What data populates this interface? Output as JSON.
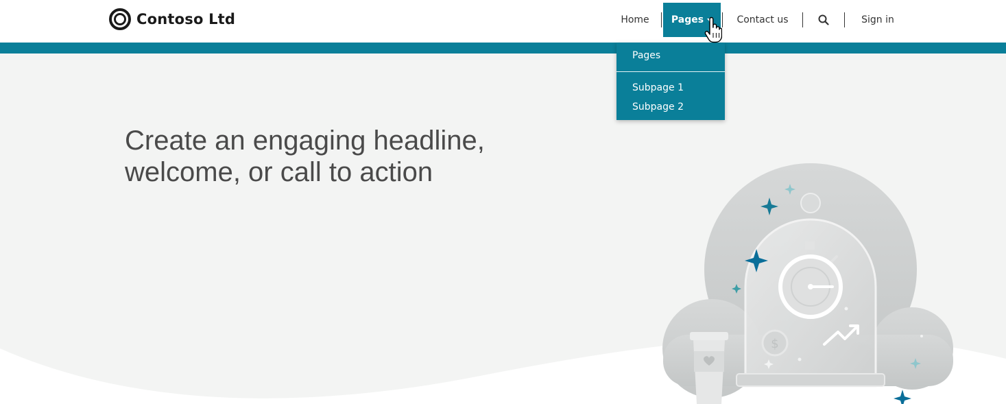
{
  "brand": {
    "name": "Contoso Ltd",
    "logo_icon": "ring-logo-icon"
  },
  "nav": {
    "items": [
      {
        "label": "Home"
      },
      {
        "label": "Pages",
        "active": true
      },
      {
        "label": "Contact us"
      },
      {
        "label": "Search",
        "icon": "search-icon"
      },
      {
        "label": "Sign in"
      }
    ]
  },
  "dropdown": {
    "items": [
      {
        "label": "Pages"
      },
      {
        "label": "Subpage 1"
      },
      {
        "label": "Subpage 2"
      }
    ]
  },
  "hero": {
    "headline": "Create an engaging headline, welcome, or call to action",
    "illustration_icon": "stopwatch-dome-illustration"
  },
  "colors": {
    "accent": "#0a7f99",
    "hero_background": "#f3f4f3",
    "headline_text": "#4a4a4a"
  }
}
